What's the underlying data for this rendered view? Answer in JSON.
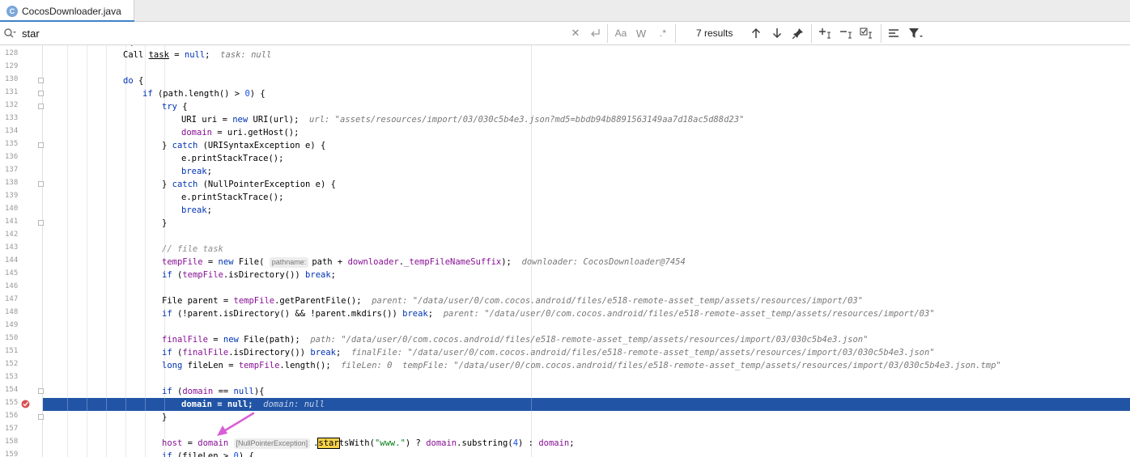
{
  "tab": {
    "title": "CocosDownloader.java",
    "icon_letter": "C"
  },
  "search": {
    "value": "star",
    "results_label": "7 results",
    "icons": [
      "search-icon",
      "clear-icon",
      "replace-icon",
      "match-case-icon",
      "words-icon",
      "regex-icon",
      "prev-occurrence-icon",
      "next-occurrence-icon",
      "pin-icon",
      "add-selection-icon",
      "remove-selection-icon",
      "select-all-icon",
      "multiline-icon",
      "filter-icon"
    ]
  },
  "editor": {
    "line_numbers": [
      "128",
      "129",
      "130",
      "131",
      "132",
      "133",
      "134",
      "135",
      "136",
      "137",
      "138",
      "139",
      "140",
      "141",
      "142",
      "143",
      "144",
      "145",
      "146",
      "147",
      "148",
      "149",
      "150",
      "151",
      "152",
      "153",
      "154",
      "155",
      "156",
      "157",
      "158",
      "159"
    ],
    "hints": {
      "task": "task: null",
      "url": "url: \"assets/resources/import/03/030c5b4e3.json?md5=bbdb94b8891563149aa7d18ac5d88d23\"",
      "pathname": "pathname:",
      "downloader": "downloader: CocosDownloader@7454",
      "parent1": "parent: \"/data/user/0/com.cocos.android/files/e518-remote-asset_temp/assets/resources/import/03\"",
      "parent2": "parent: \"/data/user/0/com.cocos.android/files/e518-remote-asset_temp/assets/resources/import/03\"",
      "path": "path: \"/data/user/0/com.cocos.android/files/e518-remote-asset_temp/assets/resources/import/03/030c5b4e3.json\"",
      "finalFile": "finalFile: \"/data/user/0/com.cocos.android/files/e518-remote-asset_temp/assets/resources/import/03/030c5b4e3.json\"",
      "fileLen": "fileLen: 0",
      "tempFile": "tempFile: \"/data/user/0/com.cocos.android/files/e518-remote-asset_temp/assets/resources/import/03/030c5b4e3.json.tmp\"",
      "domain": "domain: null",
      "exception": "[NullPointerException]"
    },
    "comment_file_task": "// file task",
    "current_line": "155",
    "find_match": "star"
  },
  "colors": {
    "highlight": "#2154a5",
    "keyword": "#0033b3",
    "field": "#871094",
    "number": "#1750eb",
    "string": "#067d17",
    "arrow": "#d95fd6"
  }
}
